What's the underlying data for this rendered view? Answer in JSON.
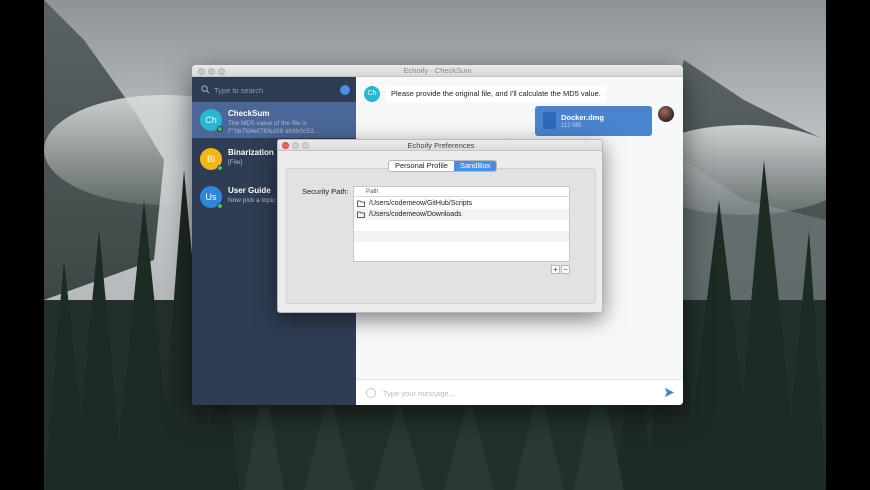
{
  "desktop": {
    "wallpaper": "mountain-forest"
  },
  "app": {
    "window_title": "Echoify - CheckSum",
    "search": {
      "placeholder": "Type to search"
    },
    "chats": [
      {
        "initials": "Ch",
        "name": "CheckSum",
        "preview": "The MD5 value of the file is f\"\"0b7fd4ef7f0bd39 ab6b0c53...",
        "avatar_color": "#27b7d1",
        "active": true
      },
      {
        "initials": "Bi",
        "name": "Binarization",
        "preview": "[File]",
        "avatar_color": "#f2b51a",
        "active": false
      },
      {
        "initials": "Us",
        "name": "User Guide",
        "preview": "Now pick a topic interested in (Yo...",
        "avatar_color": "#2f86db",
        "active": false
      }
    ],
    "conversation": {
      "bot_initials": "Ch",
      "bot_message": "Please provide the original file, and I'll calculate the MD5 value.",
      "file": {
        "name": "Docker.dmg",
        "size": "112 MB"
      }
    },
    "composer": {
      "placeholder": "Type your message..."
    }
  },
  "preferences": {
    "title": "Echoify Preferences",
    "tabs": [
      {
        "label": "Personal Profile",
        "selected": false
      },
      {
        "label": "SandBox",
        "selected": true
      }
    ],
    "security_path_label": "Security Path:",
    "table_header": "Path",
    "paths": [
      "/Users/codemeow/GitHub/Scripts",
      "/Users/codemeow/Downloads"
    ],
    "add_label": "+",
    "remove_label": "−"
  },
  "colors": {
    "sidebar": "#2f3d54",
    "active_item": "#4a6797",
    "accent": "#4a90e2",
    "file_bubble": "#4a84cf"
  }
}
